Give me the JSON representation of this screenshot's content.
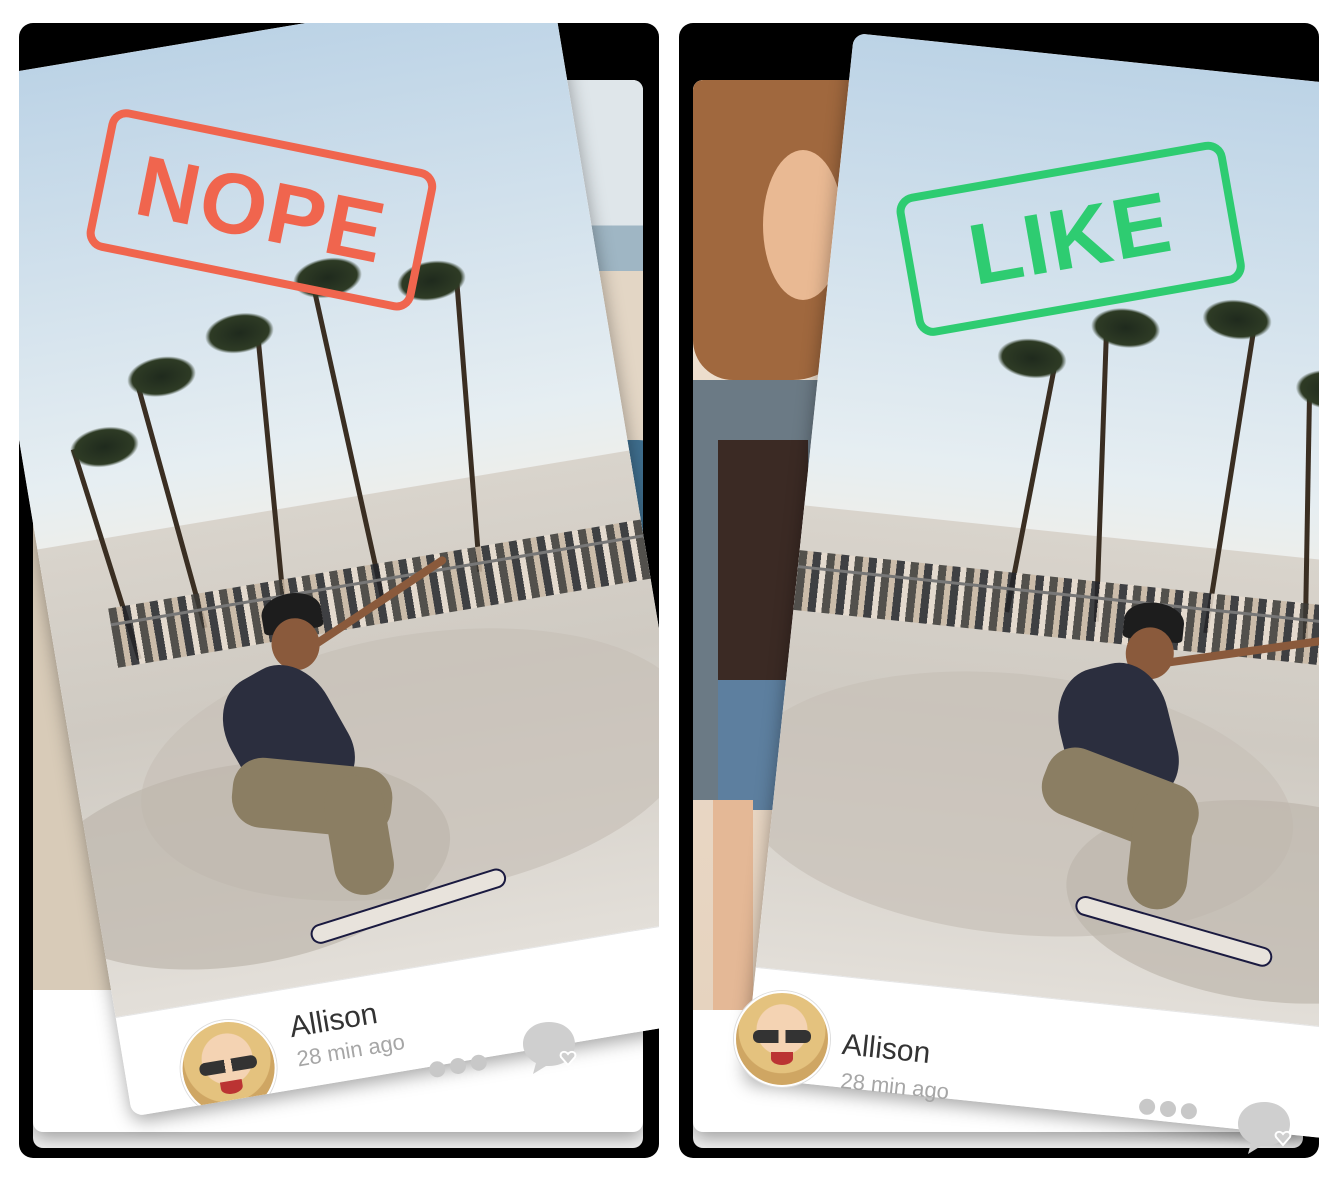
{
  "left_card": {
    "stamp": "NOPE",
    "name": "Allison",
    "time": "28 min ago",
    "stamp_color": "#f0654e"
  },
  "right_card": {
    "stamp": "LIKE",
    "name": "Allison",
    "time": "28 min ago",
    "stamp_color": "#2ecc71"
  },
  "icons": {
    "more": "more-dots-icon",
    "chat": "chat-heart-icon"
  }
}
